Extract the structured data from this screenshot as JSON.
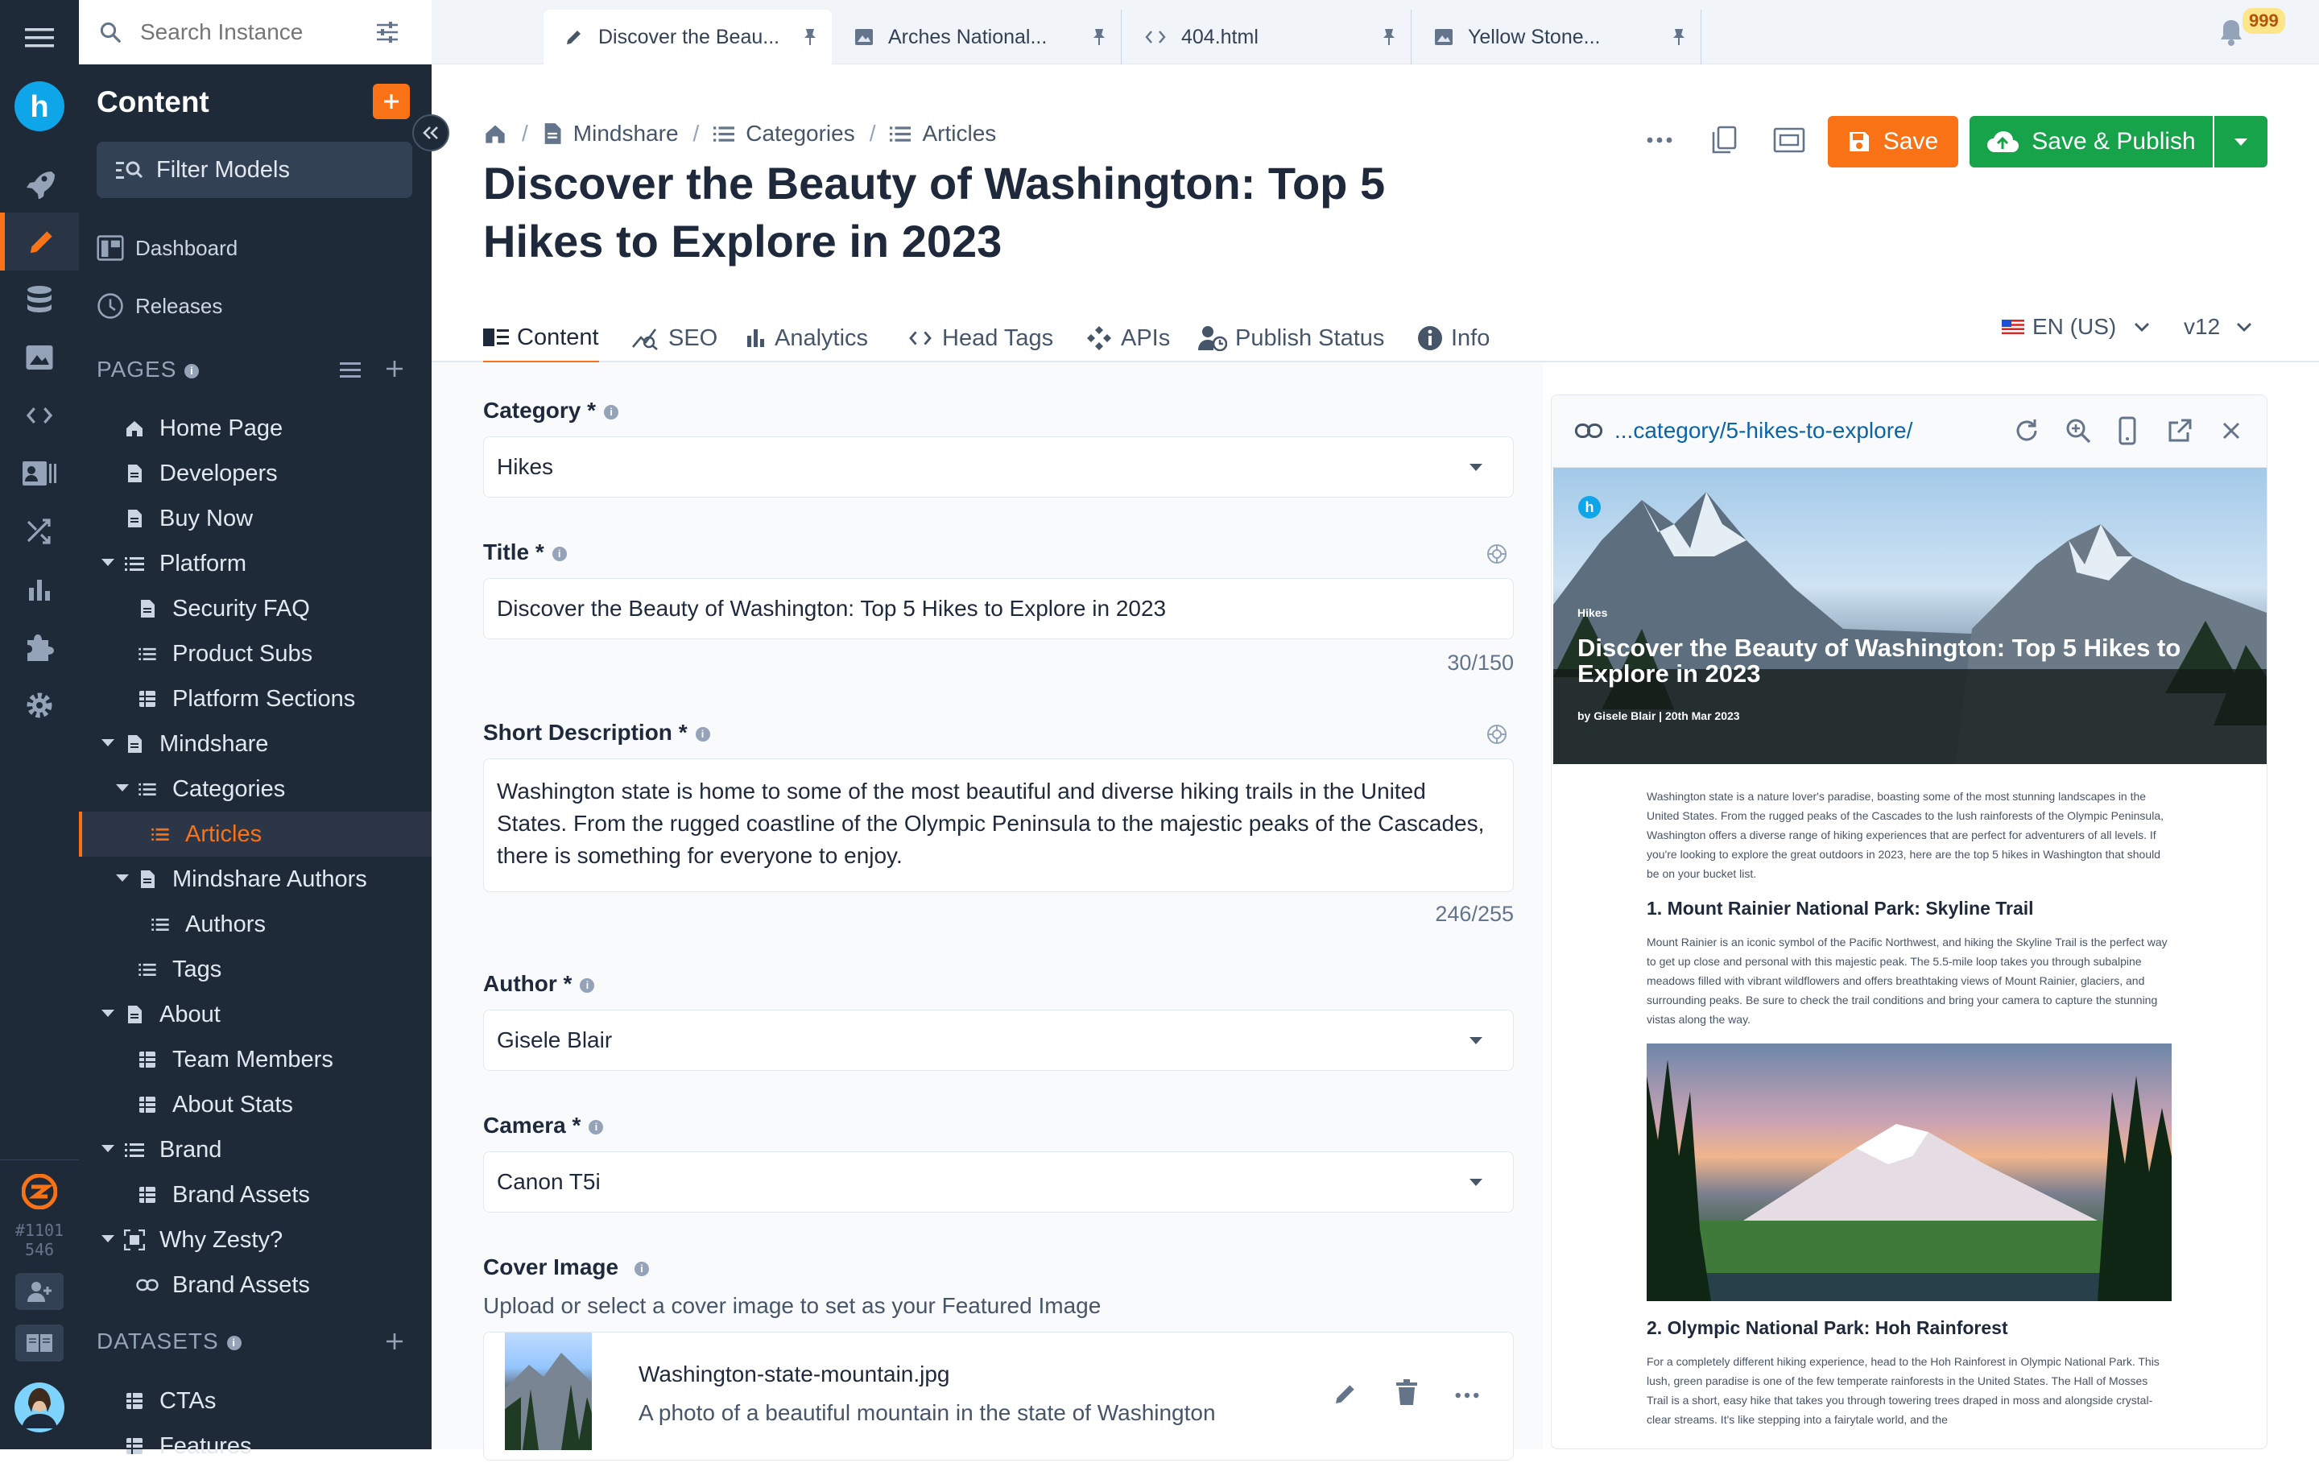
{
  "search": {
    "placeholder": "Search Instance"
  },
  "tabs": [
    {
      "label": "Discover the Beau...",
      "icon": "pencil-icon"
    },
    {
      "label": "Arches National...",
      "icon": "image-icon"
    },
    {
      "label": "404.html",
      "icon": "code-icon"
    },
    {
      "label": "Yellow Stone...",
      "icon": "image-icon"
    }
  ],
  "notifications": {
    "count": "999"
  },
  "rail": {
    "instance_id": "#1101",
    "instance_num": "546"
  },
  "sidebar": {
    "title": "Content",
    "filter_label": "Filter Models",
    "dashboard": "Dashboard",
    "releases": "Releases",
    "pages_heading": "PAGES",
    "datasets_heading": "DATASETS",
    "items": [
      {
        "label": "Home Page"
      },
      {
        "label": "Developers"
      },
      {
        "label": "Buy Now"
      },
      {
        "label": "Platform"
      },
      {
        "label": "Security FAQ"
      },
      {
        "label": "Product Subs"
      },
      {
        "label": "Platform Sections"
      },
      {
        "label": "Mindshare"
      },
      {
        "label": "Categories"
      },
      {
        "label": "Articles"
      },
      {
        "label": "Mindshare Authors"
      },
      {
        "label": "Authors"
      },
      {
        "label": "Tags"
      },
      {
        "label": "About"
      },
      {
        "label": "Team Members"
      },
      {
        "label": "About Stats"
      },
      {
        "label": "Brand"
      },
      {
        "label": "Brand Assets"
      },
      {
        "label": "Why Zesty?"
      },
      {
        "label": "Brand Assets"
      }
    ],
    "datasets": [
      {
        "label": "CTAs"
      },
      {
        "label": "Features"
      }
    ]
  },
  "breadcrumb": [
    "Mindshare",
    "Categories",
    "Articles"
  ],
  "page_title_line1": "Discover the Beauty of Washington: Top 5",
  "page_title_line2": "Hikes to Explore in 2023",
  "actions": {
    "save": "Save",
    "save_publish": "Save & Publish"
  },
  "content_tabs": [
    "Content",
    "SEO",
    "Analytics",
    "Head Tags",
    "APIs",
    "Publish Status",
    "Info"
  ],
  "locale": "EN (US)",
  "version": "v12",
  "fields": {
    "category": {
      "label": "Category *",
      "value": "Hikes"
    },
    "title": {
      "label": "Title *",
      "value": "Discover the Beauty of Washington: Top 5 Hikes to Explore in 2023",
      "counter": "30/150"
    },
    "short_description": {
      "label": "Short Description *",
      "value": "Washington state is home to some of the most beautiful and diverse hiking trails in the United States. From the rugged coastline of the Olympic Peninsula to the majestic peaks of the Cascades, there is something for everyone to enjoy.",
      "counter": "246/255"
    },
    "author": {
      "label": "Author *",
      "value": "Gisele Blair"
    },
    "camera": {
      "label": "Camera *",
      "value": "Canon T5i"
    },
    "cover_image": {
      "label": "Cover Image",
      "help": "Upload or select a cover image to set as your Featured Image",
      "filename": "Washington-state-mountain.jpg",
      "description": "A photo of a beautiful mountain in the state of Washington"
    }
  },
  "preview": {
    "url": "...category/5-hikes-to-explore/",
    "hero_category": "Hikes",
    "hero_title": "Discover the Beauty of Washington: Top 5 Hikes to Explore in 2023",
    "hero_byline": "by Gisele Blair | 20th Mar 2023",
    "intro": "Washington state is a nature lover's paradise, boasting some of the most stunning landscapes in the United States. From the rugged peaks of the Cascades to the lush rainforests of the Olympic Peninsula, Washington offers a diverse range of hiking experiences that are perfect for adventurers of all levels. If you're looking to explore the great outdoors in 2023, here are the top 5 hikes in Washington that should be on your bucket list.",
    "h1": "1. Mount Rainier National Park: Skyline Trail",
    "p1": "Mount Rainier is an iconic symbol of the Pacific Northwest, and hiking the Skyline Trail is the perfect way to get up close and personal with this majestic peak. The 5.5-mile loop takes you through subalpine meadows filled with vibrant wildflowers and offers breathtaking views of Mount Rainier, glaciers, and surrounding peaks. Be sure to check the trail conditions and bring your camera to capture the stunning vistas along the way.",
    "h2": "2. Olympic National Park: Hoh Rainforest",
    "p2": "For a completely different hiking experience, head to the Hoh Rainforest in Olympic National Park. This lush, green paradise is one of the few temperate rainforests in the United States. The Hall of Mosses Trail is a short, easy hike that takes you through towering trees draped in moss and alongside crystal-clear streams. It's like stepping into a fairytale world, and the"
  },
  "colors": {
    "accent": "#f97316",
    "publish": "#16a34a",
    "rail": "#1f2a38",
    "link": "#0b63a8"
  }
}
